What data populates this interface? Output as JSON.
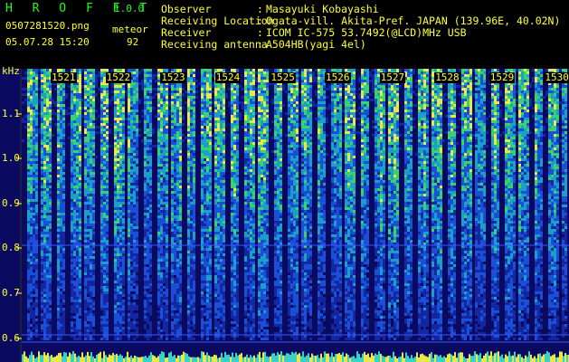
{
  "header": {
    "app_title": "H R O F F T",
    "app_version": "1.0.0",
    "file_name": "0507281520.png",
    "mode_label": "meteor",
    "datetime": "05.07.28 15:20",
    "count_value": "92",
    "info": [
      {
        "label": "Observer",
        "value": "Masayuki Kobayashi"
      },
      {
        "label": "Receiving Location",
        "value": "Ogata-vill. Akita-Pref. JAPAN (139.96E, 40.02N)"
      },
      {
        "label": "Receiver",
        "value": "ICOM IC-575 53.7492(@LCD)MHz USB"
      },
      {
        "label": "Receiving antenna",
        "value": "A504HB(yagi 4el)"
      }
    ],
    "colon": ":"
  },
  "spectrogram": {
    "unit_label": "kHz",
    "freq_ticks": [
      {
        "label": "1.1",
        "value": 1.1
      },
      {
        "label": "1.0",
        "value": 1.0
      },
      {
        "label": "0.9",
        "value": 0.9
      },
      {
        "label": "0.8",
        "value": 0.8
      },
      {
        "label": "0.7",
        "value": 0.7
      },
      {
        "label": "0.6",
        "value": 0.6
      }
    ],
    "minute_labels": [
      "1521",
      "1522",
      "1523",
      "1524",
      "1525",
      "1526",
      "1527",
      "1528",
      "1529",
      "1530"
    ],
    "colors": {
      "background": "#0a0a60",
      "text": "#ffff33",
      "green_text": "#1aff1a",
      "reference_line": "#3a55ff"
    }
  }
}
